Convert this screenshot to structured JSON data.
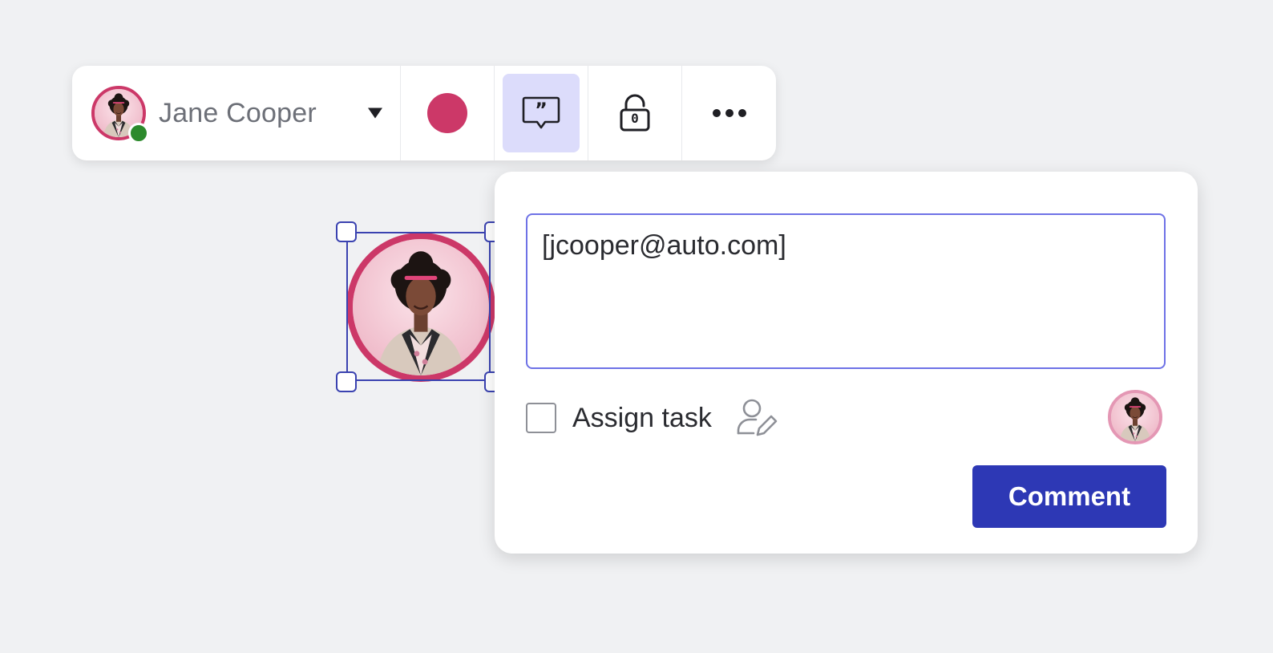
{
  "toolbar": {
    "user_name": "Jane Cooper",
    "user_status": "online",
    "selected_color": "#cc3868",
    "lock_count": "0",
    "active_tool": "comment"
  },
  "comment_popover": {
    "input_value": "[jcooper@auto.com]",
    "assign_label": "Assign task",
    "assign_checked": false,
    "submit_label": "Comment"
  },
  "colors": {
    "accent": "#2d38b5",
    "brand_pink": "#cc3868",
    "selection": "#3a42b0",
    "input_focus": "#6e72e6",
    "active_tool_bg": "#dcdcfb",
    "online": "#2c8a2c"
  },
  "icons": {
    "caret": "caret-down-icon",
    "comment": "comment-quote-icon",
    "lock": "unlock-icon",
    "more": "more-horizontal-icon",
    "assign": "user-edit-icon"
  }
}
